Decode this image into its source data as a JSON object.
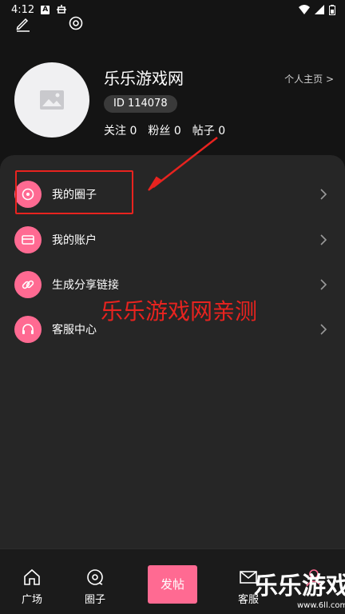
{
  "status_bar": {
    "time": "4:12",
    "icon_a": "A"
  },
  "profile": {
    "name": "乐乐游戏网",
    "homepage_link": "个人主页 >",
    "id_badge": "ID 114078",
    "stats": [
      {
        "label": "关注",
        "value": "0"
      },
      {
        "label": "粉丝",
        "value": "0"
      },
      {
        "label": "帖子",
        "value": "0"
      }
    ]
  },
  "menu": [
    {
      "label": "我的圈子",
      "icon": "circle-icon"
    },
    {
      "label": "我的账户",
      "icon": "wallet-icon"
    },
    {
      "label": "生成分享链接",
      "icon": "link-icon"
    },
    {
      "label": "客服中心",
      "icon": "headset-icon"
    }
  ],
  "overlay_text": "乐乐游戏网亲测",
  "tabbar": {
    "plaza": "广场",
    "circle": "圈子",
    "post": "发帖",
    "service": "客服"
  },
  "watermark": {
    "main": "乐乐游戏",
    "sub": "www.6ll.com"
  },
  "colors": {
    "accent": "#ff6a92",
    "annotation": "#e8231f",
    "background": "#141414",
    "panel": "#262626"
  }
}
